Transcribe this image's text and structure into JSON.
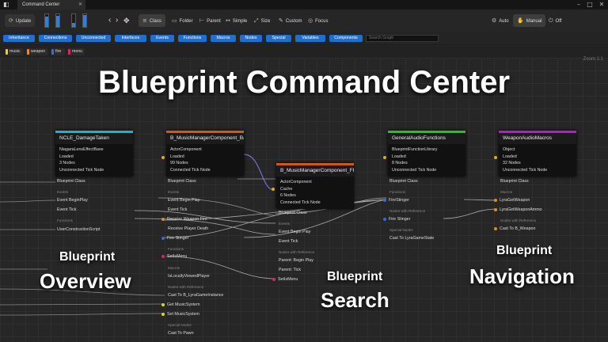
{
  "window": {
    "title": "Command Center",
    "close_glyph": "✕"
  },
  "toolbar": {
    "update_label": "Update",
    "meters": [
      0.8,
      0.9,
      0.3,
      0.95
    ],
    "nav_prev": "‹",
    "nav_next": "›",
    "group_buttons": [
      "Class",
      "Folder",
      "Parent",
      "Simple",
      "Size",
      "Custom",
      "Focus"
    ],
    "mode_buttons": [
      "Auto",
      "Manual",
      "Off"
    ]
  },
  "filters": [
    "Inheritance",
    "Connections",
    "Unconnected",
    "Interfaces",
    "Events",
    "Functions",
    "Macros",
    "Nodes",
    "Special",
    "Variables",
    "Components"
  ],
  "search": {
    "placeholder": "Search Graph"
  },
  "tags": [
    {
      "name": "music",
      "color": "#e8d021"
    },
    {
      "name": "weapon",
      "color": "#e88a21"
    },
    {
      "name": "fire",
      "color": "#2f6ee0"
    },
    {
      "name": "menu",
      "color": "#d8265e"
    }
  ],
  "zoom_label": "Zoom 1:1",
  "headline": "Blueprint Command Center",
  "nodes": [
    {
      "title": "NCLE_DamageTaken",
      "color": "#20b0d0",
      "lines": [
        "NiagaraLensEffectBase",
        "Loaded",
        "3 Nodes",
        "Unconnected Tick Node"
      ]
    },
    {
      "title": "B_MusicManagerComponent_Ba",
      "color": "#d0581c",
      "lines": [
        "ActorComponent",
        "Loaded",
        "99 Nodes",
        "Connected Tick Node"
      ]
    },
    {
      "title": "B_MusicManagerComponent_FE",
      "color": "#d0581c",
      "lines": [
        "ActorComponent",
        "Cache",
        "6 Nodes",
        "Connected Tick Node"
      ]
    },
    {
      "title": "GeneralAudioFunctions",
      "color": "#28c028",
      "lines": [
        "BlueprintFunctionLibrary",
        "Loaded",
        "8 Nodes",
        "Unconnected Tick Node"
      ]
    },
    {
      "title": "WeaponAudioMacros",
      "color": "#b020c8",
      "lines": [
        "Object",
        "Loaded",
        "32 Nodes",
        "Unconnected Tick Node"
      ]
    }
  ],
  "col1": {
    "class": "Blueprint Class",
    "events_hdr": "Events",
    "items": [
      "Event BeginPlay",
      "Event Tick"
    ],
    "functions_hdr": "Functions",
    "functions": [
      "UserConstructionScript"
    ]
  },
  "col2": {
    "class": "Blueprint Class",
    "events_hdr": "Events",
    "events": [
      "Event Begin Play",
      "Event Tick",
      "Receive Weapon Fire",
      "Receive Player Death",
      "Fire Stinger"
    ],
    "functions_hdr": "Functions",
    "functions": [
      "SetIsMenu"
    ],
    "macros_hdr": "Macros",
    "macros": [
      "IsLocallyViewedPlayer"
    ],
    "refs_hdr": "Nodes with Reference",
    "refs": [
      "Cast To B_LyraGameInstance",
      "Get MusicSystem",
      "Set MusicSystem"
    ],
    "special_hdr": "Special Nodes",
    "special": [
      "Cast To Pawn"
    ]
  },
  "col3": {
    "class": "Blueprint Class",
    "events_hdr": "Events",
    "events": [
      "Event Begin Play",
      "Event Tick"
    ],
    "refs_hdr": "Nodes with Reference",
    "refs": [
      "Parent: Begin Play",
      "Parent: Tick",
      "SetIsMenu"
    ]
  },
  "col4": {
    "class": "Blueprint Class",
    "functions_hdr": "Functions",
    "functions": [
      "FireStinger"
    ],
    "refs_hdr": "Nodes with Reference",
    "refs": [
      "Fire Stinger"
    ],
    "special_hdr": "Special Nodes",
    "special": [
      "Cast To LyraGameState"
    ]
  },
  "col5": {
    "class": "Blueprint Class",
    "macros_hdr": "Macros",
    "macros": [
      "LyraGetWeapon",
      "LyraGetWeaponAmmo"
    ],
    "refs_hdr": "Nodes with Reference",
    "refs": [
      "Cast To B_Weapon"
    ]
  },
  "captions": {
    "overview": [
      "Blueprint",
      "Overview"
    ],
    "search": [
      "Blueprint",
      "Search"
    ],
    "navigation": [
      "Blueprint",
      "Navigation"
    ]
  }
}
